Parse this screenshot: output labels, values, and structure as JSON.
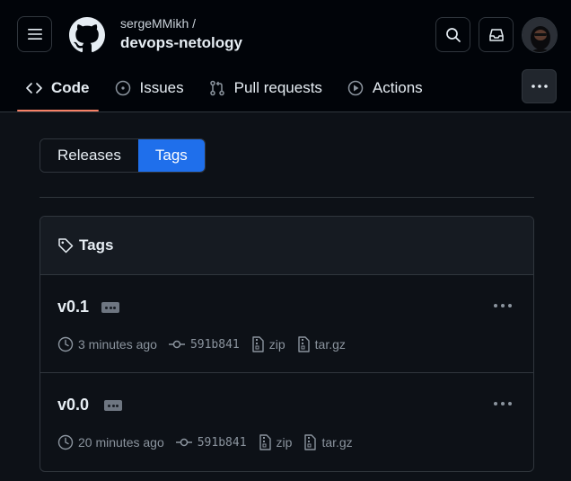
{
  "header": {
    "owner": "sergeMMikh /",
    "repo": "devops-netology"
  },
  "tabs": [
    {
      "label": "Code",
      "icon": "code-icon",
      "active": true
    },
    {
      "label": "Issues",
      "icon": "issue-icon",
      "active": false
    },
    {
      "label": "Pull requests",
      "icon": "pull-request-icon",
      "active": false
    },
    {
      "label": "Actions",
      "icon": "play-icon",
      "active": false
    }
  ],
  "segmented": {
    "releases": "Releases",
    "tags": "Tags",
    "selected": "Tags"
  },
  "tags_box": {
    "title": "Tags",
    "items": [
      {
        "name": "v0.1",
        "time": "3 minutes ago",
        "commit": "591b841",
        "zip": "zip",
        "targz": "tar.gz"
      },
      {
        "name": "v0.0",
        "time": "20 minutes ago",
        "commit": "591b841",
        "zip": "zip",
        "targz": "tar.gz"
      }
    ]
  },
  "colors": {
    "accent": "#1f6feb",
    "tab_underline": "#f78166",
    "background": "#0d1117",
    "header_bg": "#010409"
  }
}
